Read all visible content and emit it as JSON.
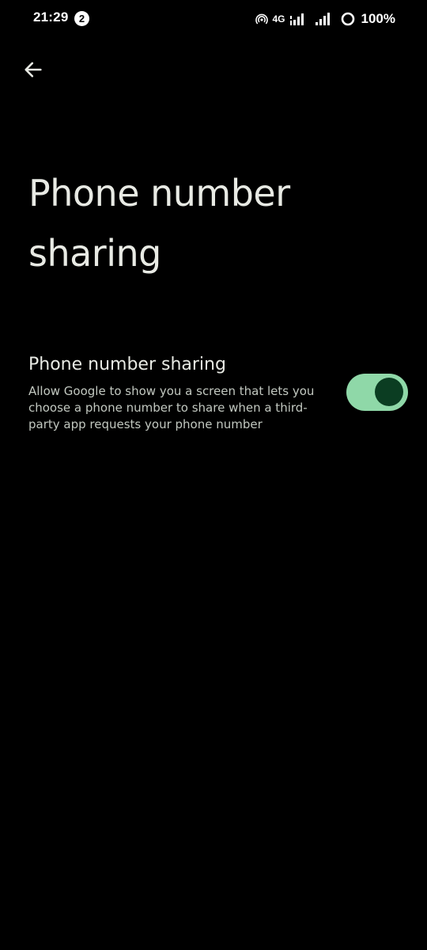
{
  "status_bar": {
    "time": "21:29",
    "notification_count": "2",
    "network_type": "4G",
    "battery": "100%",
    "icons": [
      "hotspot-icon",
      "signal-icon",
      "signal-icon-2",
      "battery-icon"
    ]
  },
  "header": {
    "back_icon": "arrow-back-icon",
    "title": "Phone number sharing"
  },
  "setting": {
    "title": "Phone number sharing",
    "description": "Allow Google to show you a screen that lets you choose a phone number to share when a third-party app requests your phone number",
    "toggle_on": true
  },
  "colors": {
    "background": "#000000",
    "toggle_track": "#8fd8a8",
    "toggle_thumb": "#0b3d22",
    "text_primary": "#e8eae4",
    "text_secondary": "#c2c8c0"
  }
}
